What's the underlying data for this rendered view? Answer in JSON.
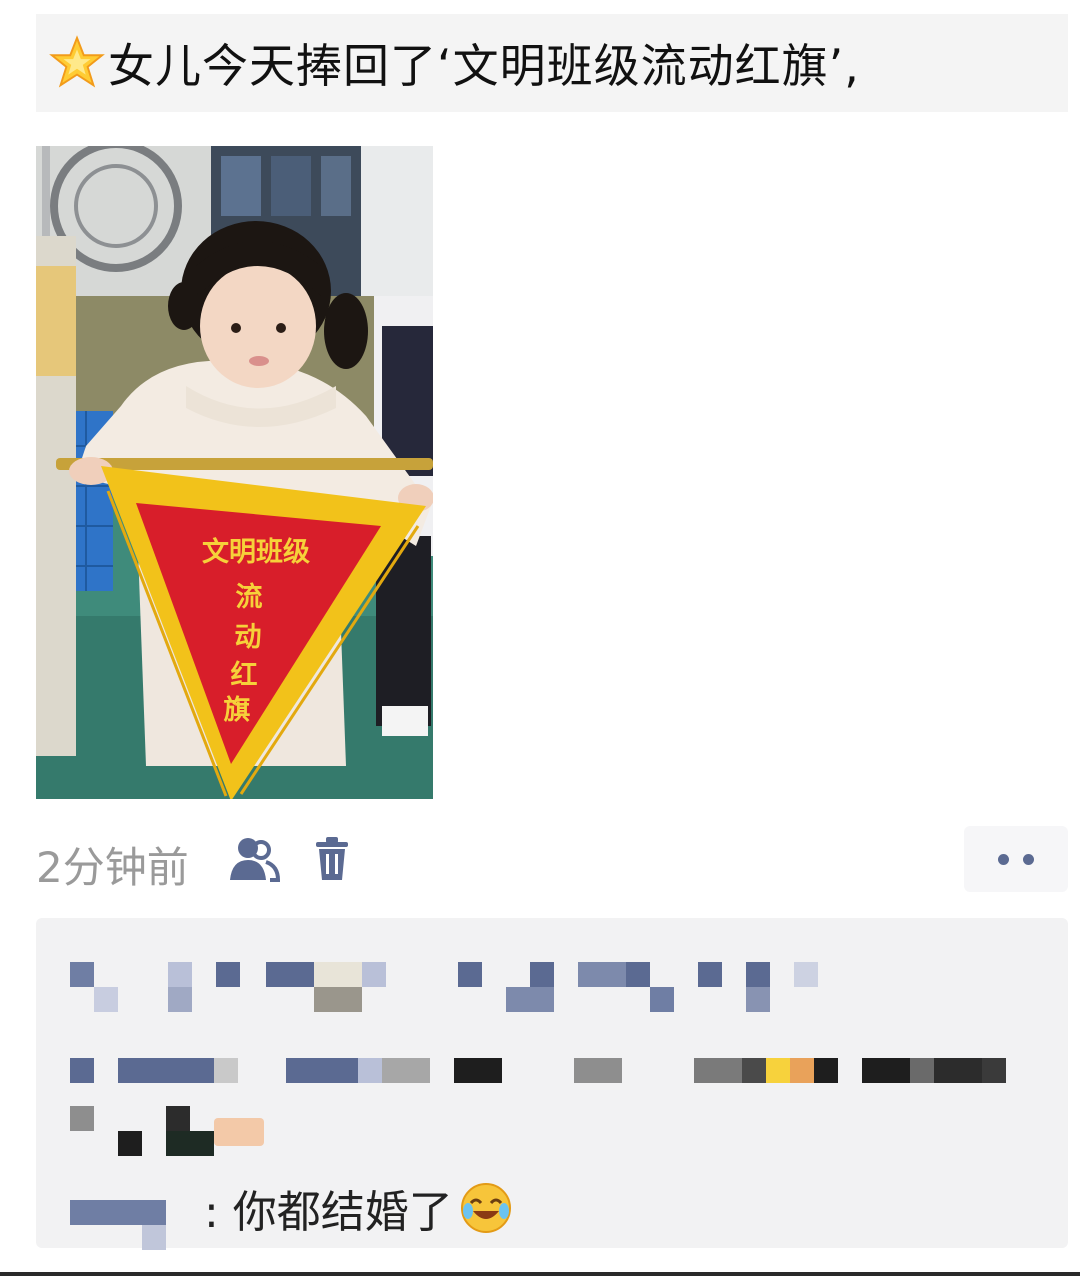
{
  "post": {
    "text": "女儿今天捧回了‘文明班级流动红旗’,",
    "emoji_icon": "glowing-star-icon"
  },
  "photo": {
    "pennant_lines": [
      "文明班级",
      "流",
      "动",
      "红",
      "旗"
    ]
  },
  "meta": {
    "timestamp": "2分钟前",
    "icons": [
      "friends-visibility-icon",
      "trash-icon",
      "more-dots-icon"
    ]
  },
  "comments": {
    "visible_text": ": 你都结婚了",
    "emoji_icon": "laughing-crying-face-icon"
  },
  "colors": {
    "post_bg": "#f4f4f4",
    "comment_bg": "#f2f2f3",
    "icon_blue": "#5b6a92",
    "timestamp_gray": "#9a9a9a",
    "pennant_red": "#d81e2a",
    "pennant_gold": "#f2c21a"
  }
}
